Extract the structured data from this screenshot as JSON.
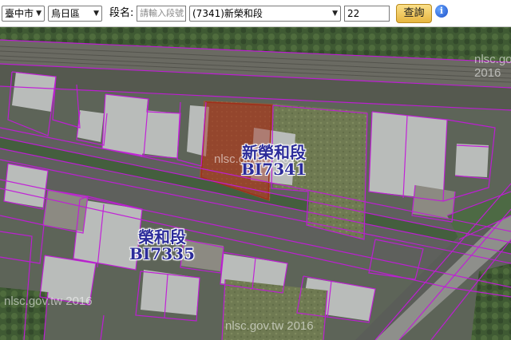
{
  "toolbar": {
    "city": "臺中市",
    "district": "烏日區",
    "section_label": "段名:",
    "section_placeholder": "請輸入段號",
    "section_value": "(7341)新榮和段",
    "lot_value": "22",
    "search_label": "查詢",
    "info_glyph": "i"
  },
  "map": {
    "parcels": [
      {
        "name": "新榮和段",
        "code": "BI7341"
      },
      {
        "name": "榮和段",
        "code": "BI7335"
      }
    ],
    "watermarks": [
      "nlsc.gov.tw 2016",
      "nlsc.gov.tw 2016",
      "nlsc.gov.tw 2016",
      "nlsc.gov.tw 2016"
    ],
    "highlight_color": "#a02f1a",
    "boundary_color": "#c21bd9"
  }
}
